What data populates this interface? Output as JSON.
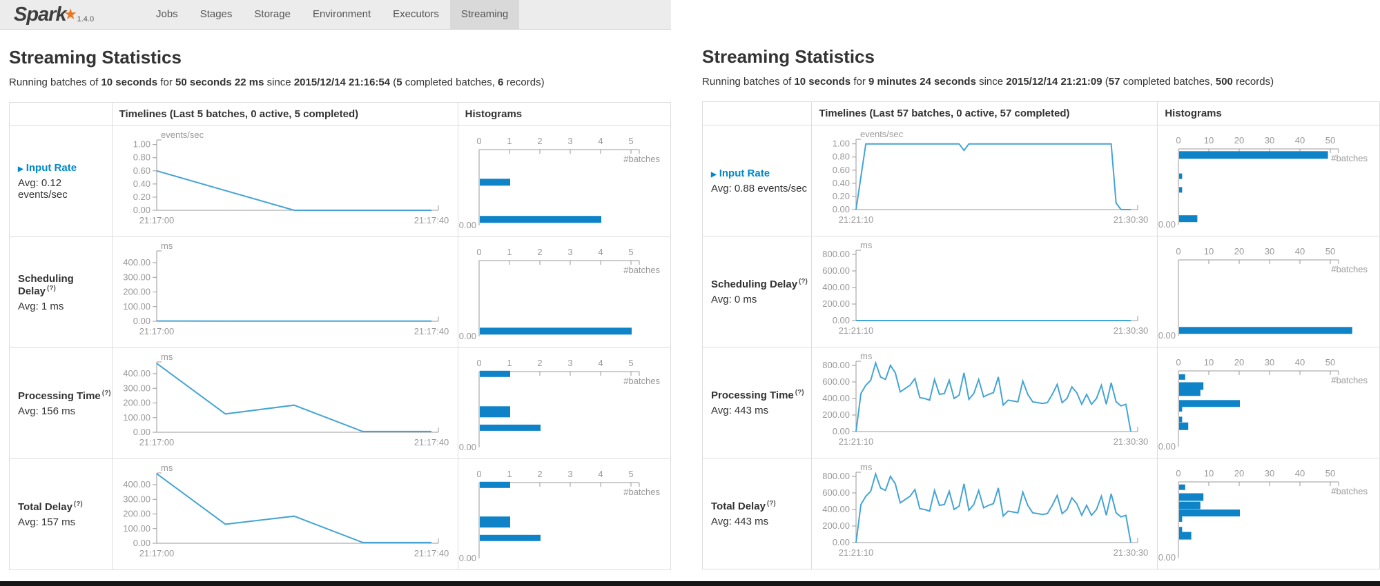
{
  "nav": {
    "logo": "Spark",
    "version": "1.4.0",
    "items": [
      "Jobs",
      "Stages",
      "Storage",
      "Environment",
      "Executors",
      "Streaming"
    ],
    "active": "Streaming"
  },
  "colors": {
    "line": "#44a4d5",
    "bar": "#0e83c8",
    "link": "#0088cc",
    "axis": "#999999"
  },
  "panels": [
    {
      "title": "Streaming Statistics",
      "status": {
        "t1": "Running batches of",
        "interval": "10 seconds",
        "t2": "for",
        "duration": "50 seconds 22 ms",
        "t3": "since",
        "date": "2015/12/14 21:16:54",
        "t4": "(",
        "batches": "5",
        "t5": "completed batches,",
        "records": "6",
        "t6": "records)"
      },
      "table_header": {
        "timelines": "Timelines (Last 5 batches, 0 active, 5 completed)",
        "histograms": "Histograms"
      },
      "rows": [
        {
          "label": "Input Rate",
          "link": true,
          "avg": "Avg: 0.12 events/sec",
          "timeline": {
            "unit": "events/sec",
            "ymax": 1.07,
            "yticks": [
              {
                "l": "1.00",
                "v": 1
              },
              {
                "l": "0.80",
                "v": 0.8
              },
              {
                "l": "0.60",
                "v": 0.6
              },
              {
                "l": "0.40",
                "v": 0.4
              },
              {
                "l": "0.20",
                "v": 0.2
              },
              {
                "l": "0.00",
                "v": 0
              }
            ],
            "values": [
              0.6,
              0.3,
              0,
              0,
              0
            ],
            "x_start": "21:17:00",
            "x_end": "21:17:40"
          },
          "histogram": {
            "xticks": [
              0,
              1,
              2,
              3,
              4,
              5
            ],
            "batches_label": "#batches",
            "zero_label": "0.00",
            "bars": [
              {
                "f": 0.43,
                "c": 1,
                "h": 10
              },
              {
                "f": 0.92,
                "c": 4,
                "h": 10
              }
            ]
          }
        },
        {
          "label": "Scheduling Delay",
          "help": "(?)",
          "avg": "Avg: 1 ms",
          "timeline": {
            "unit": "ms",
            "ymax": 480,
            "yticks": [
              {
                "l": "400.00",
                "v": 400
              },
              {
                "l": "300.00",
                "v": 300
              },
              {
                "l": "200.00",
                "v": 200
              },
              {
                "l": "100.00",
                "v": 100
              },
              {
                "l": "0.00",
                "v": 0
              }
            ],
            "values": [
              2,
              1,
              1,
              1,
              1
            ],
            "x_start": "21:17:00",
            "x_end": "21:17:40"
          },
          "histogram": {
            "xticks": [
              0,
              1,
              2,
              3,
              4,
              5
            ],
            "batches_label": "#batches",
            "zero_label": "0.00",
            "bars": [
              {
                "f": 0.93,
                "c": 5,
                "h": 10
              }
            ]
          }
        },
        {
          "label": "Processing Time",
          "help": "(?)",
          "avg": "Avg: 156 ms",
          "timeline": {
            "unit": "ms",
            "ymax": 480,
            "yticks": [
              {
                "l": "400.00",
                "v": 400
              },
              {
                "l": "300.00",
                "v": 300
              },
              {
                "l": "200.00",
                "v": 200
              },
              {
                "l": "100.00",
                "v": 100
              },
              {
                "l": "0.00",
                "v": 0
              }
            ],
            "values": [
              470,
              125,
              185,
              5,
              5
            ],
            "x_start": "21:17:00",
            "x_end": "21:17:40"
          },
          "histogram": {
            "xticks": [
              0,
              1,
              2,
              3,
              4,
              5
            ],
            "batches_label": "#batches",
            "zero_label": "0.00",
            "bars": [
              {
                "f": 0.03,
                "c": 1,
                "h": 9
              },
              {
                "f": 0.53,
                "c": 1,
                "h": 16
              },
              {
                "f": 0.74,
                "c": 2,
                "h": 9
              }
            ]
          }
        },
        {
          "label": "Total Delay",
          "help": "(?)",
          "avg": "Avg: 157 ms",
          "timeline": {
            "unit": "ms",
            "ymax": 480,
            "yticks": [
              {
                "l": "400.00",
                "v": 400
              },
              {
                "l": "300.00",
                "v": 300
              },
              {
                "l": "200.00",
                "v": 200
              },
              {
                "l": "100.00",
                "v": 100
              },
              {
                "l": "0.00",
                "v": 0
              }
            ],
            "values": [
              475,
              130,
              185,
              5,
              5
            ],
            "x_start": "21:17:00",
            "x_end": "21:17:40"
          },
          "histogram": {
            "xticks": [
              0,
              1,
              2,
              3,
              4,
              5
            ],
            "batches_label": "#batches",
            "zero_label": "0.00",
            "bars": [
              {
                "f": 0.03,
                "c": 1,
                "h": 9
              },
              {
                "f": 0.52,
                "c": 1,
                "h": 16
              },
              {
                "f": 0.73,
                "c": 2,
                "h": 9
              }
            ]
          }
        }
      ]
    },
    {
      "title": "Streaming Statistics",
      "status": {
        "t1": "Running batches of",
        "interval": "10 seconds",
        "t2": "for",
        "duration": "9 minutes 24 seconds",
        "t3": "since",
        "date": "2015/12/14 21:21:09",
        "t4": "(",
        "batches": "57",
        "t5": "completed batches,",
        "records": "500",
        "t6": "records)"
      },
      "table_header": {
        "timelines": "Timelines (Last 57 batches, 0 active, 57 completed)",
        "histograms": "Histograms"
      },
      "rows": [
        {
          "label": "Input Rate",
          "link": true,
          "avg": "Avg: 0.88 events/sec",
          "timeline": {
            "unit": "events/sec",
            "ymax": 1.07,
            "yticks": [
              {
                "l": "1.00",
                "v": 1
              },
              {
                "l": "0.80",
                "v": 0.8
              },
              {
                "l": "0.60",
                "v": 0.6
              },
              {
                "l": "0.40",
                "v": 0.4
              },
              {
                "l": "0.20",
                "v": 0.2
              },
              {
                "l": "0.00",
                "v": 0
              }
            ],
            "values": [
              0,
              0.5,
              1,
              1,
              1,
              1,
              1,
              1,
              1,
              1,
              1,
              1,
              1,
              1,
              1,
              1,
              1,
              1,
              1,
              1,
              1,
              1,
              0.9,
              1,
              1,
              1,
              1,
              1,
              1,
              1,
              1,
              1,
              1,
              1,
              1,
              1,
              1,
              1,
              1,
              1,
              1,
              1,
              1,
              1,
              1,
              1,
              1,
              1,
              1,
              1,
              1,
              1,
              1,
              0.1,
              0,
              0,
              0
            ],
            "x_start": "21:21:10",
            "x_end": "21:30:30"
          },
          "histogram": {
            "xticks": [
              0,
              10,
              20,
              30,
              40,
              50
            ],
            "batches_label": "#batches",
            "zero_label": "0.00",
            "bars": [
              {
                "f": 0.08,
                "c": 49,
                "h": 11
              },
              {
                "f": 0.36,
                "c": 1,
                "h": 8
              },
              {
                "f": 0.54,
                "c": 1,
                "h": 8
              },
              {
                "f": 0.92,
                "c": 6,
                "h": 10
              }
            ]
          }
        },
        {
          "label": "Scheduling Delay",
          "help": "(?)",
          "avg": "Avg: 0 ms",
          "timeline": {
            "unit": "ms",
            "ymax": 850,
            "yticks": [
              {
                "l": "800.00",
                "v": 800
              },
              {
                "l": "600.00",
                "v": 600
              },
              {
                "l": "400.00",
                "v": 400
              },
              {
                "l": "200.00",
                "v": 200
              },
              {
                "l": "0.00",
                "v": 0
              }
            ],
            "values": [
              0,
              0,
              0,
              0,
              0,
              0,
              0,
              0,
              0,
              0
            ],
            "x_start": "21:21:10",
            "x_end": "21:30:30"
          },
          "histogram": {
            "xticks": [
              0,
              10,
              20,
              30,
              40,
              50
            ],
            "batches_label": "#batches",
            "zero_label": "0.00",
            "bars": [
              {
                "f": 0.93,
                "c": 57,
                "h": 10
              }
            ]
          }
        },
        {
          "label": "Processing Time",
          "help": "(?)",
          "avg": "Avg: 443 ms",
          "timeline": {
            "unit": "ms",
            "ymax": 850,
            "yticks": [
              {
                "l": "800.00",
                "v": 800
              },
              {
                "l": "600.00",
                "v": 600
              },
              {
                "l": "400.00",
                "v": 400
              },
              {
                "l": "200.00",
                "v": 200
              },
              {
                "l": "0.00",
                "v": 0
              }
            ],
            "values": [
              0,
              460,
              560,
              620,
              830,
              660,
              630,
              800,
              710,
              480,
              520,
              560,
              640,
              410,
              400,
              380,
              630,
              450,
              460,
              620,
              400,
              440,
              710,
              390,
              460,
              630,
              420,
              450,
              470,
              660,
              320,
              380,
              370,
              360,
              610,
              450,
              360,
              350,
              340,
              350,
              450,
              570,
              350,
              400,
              540,
              470,
              330,
              450,
              330,
              400,
              560,
              330,
              590,
              360,
              310,
              330,
              0
            ],
            "x_start": "21:21:10",
            "x_end": "21:30:30"
          },
          "histogram": {
            "xticks": [
              0,
              10,
              20,
              30,
              40,
              50
            ],
            "batches_label": "#batches",
            "zero_label": "0.00",
            "bars": [
              {
                "f": 0.08,
                "c": 2,
                "h": 8
              },
              {
                "f": 0.2,
                "c": 8,
                "h": 11
              },
              {
                "f": 0.28,
                "c": 7,
                "h": 11
              },
              {
                "f": 0.43,
                "c": 20,
                "h": 10
              },
              {
                "f": 0.5,
                "c": 1,
                "h": 8
              },
              {
                "f": 0.64,
                "c": 1,
                "h": 8
              },
              {
                "f": 0.73,
                "c": 3,
                "h": 11
              }
            ]
          }
        },
        {
          "label": "Total Delay",
          "help": "(?)",
          "avg": "Avg: 443 ms",
          "timeline": {
            "unit": "ms",
            "ymax": 850,
            "yticks": [
              {
                "l": "800.00",
                "v": 800
              },
              {
                "l": "600.00",
                "v": 600
              },
              {
                "l": "400.00",
                "v": 400
              },
              {
                "l": "200.00",
                "v": 200
              },
              {
                "l": "0.00",
                "v": 0
              }
            ],
            "values": [
              0,
              460,
              560,
              620,
              830,
              660,
              630,
              800,
              710,
              480,
              520,
              560,
              640,
              410,
              400,
              380,
              630,
              450,
              460,
              620,
              400,
              440,
              710,
              390,
              460,
              630,
              420,
              450,
              470,
              660,
              320,
              380,
              370,
              360,
              610,
              450,
              360,
              350,
              340,
              350,
              450,
              570,
              350,
              400,
              540,
              470,
              330,
              450,
              330,
              400,
              560,
              330,
              590,
              360,
              310,
              330,
              0
            ],
            "x_start": "21:21:10",
            "x_end": "21:30:30"
          },
          "histogram": {
            "xticks": [
              0,
              10,
              20,
              30,
              40,
              50
            ],
            "batches_label": "#batches",
            "zero_label": "0.00",
            "bars": [
              {
                "f": 0.07,
                "c": 2,
                "h": 8
              },
              {
                "f": 0.2,
                "c": 8,
                "h": 11
              },
              {
                "f": 0.31,
                "c": 7,
                "h": 11
              },
              {
                "f": 0.41,
                "c": 20,
                "h": 10
              },
              {
                "f": 0.49,
                "c": 1,
                "h": 8
              },
              {
                "f": 0.63,
                "c": 1,
                "h": 8
              },
              {
                "f": 0.71,
                "c": 4,
                "h": 11
              }
            ]
          }
        }
      ]
    }
  ]
}
